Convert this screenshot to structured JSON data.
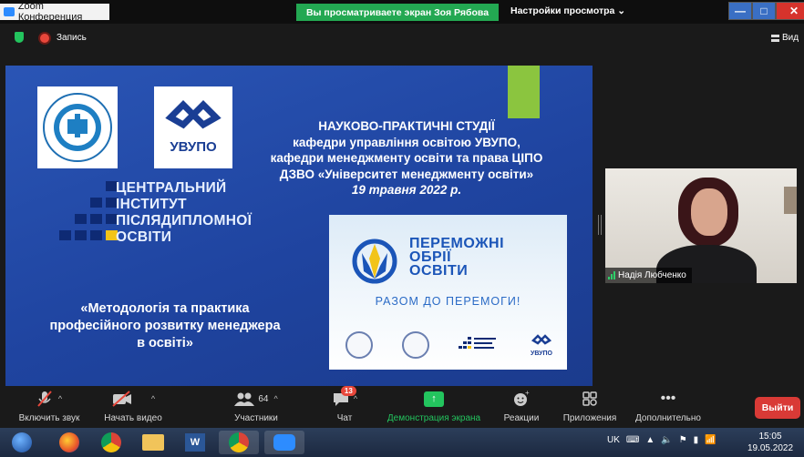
{
  "window": {
    "app_title": "Zoom Конференция",
    "share_banner": "Вы просматриваете экран Зоя Рябова",
    "view_options": "Настройки просмотра"
  },
  "meeting": {
    "recording_label": "Запись",
    "view_label": "Вид"
  },
  "slide": {
    "uvupo_logo_text": "УВУПО",
    "cipo_lines": [
      "ЦЕНТРАЛЬНИЙ",
      "ІНСТИТУТ",
      "ПІСЛЯДИПЛОМНОЇ",
      "ОСВІТИ"
    ],
    "heading_lines": [
      "НАУКОВО-ПРАКТИЧНІ СТУДІЇ",
      "кафедри управління освітою УВУПО,",
      "кафедри менеджменту освіти та права ЦІПО",
      "ДЗВО «Університет менеджменту освіти»"
    ],
    "date": "19 травня 2022 р.",
    "topic_lines": [
      "«Методологія та практика",
      "професійного розвитку менеджера",
      "в освіті»"
    ],
    "poster": {
      "title_lines": [
        "ПЕРЕМОЖНІ",
        "ОБРІЇ",
        "ОСВІТИ"
      ],
      "slogan": "РАЗОМ ДО ПЕРЕМОГИ!",
      "mini_uvupo": "УВУПО"
    }
  },
  "participant": {
    "name": "Надія Любченко"
  },
  "toolbar": {
    "mute": "Включить звук",
    "video": "Начать видео",
    "participants": "Участники",
    "participants_count": "64",
    "chat": "Чат",
    "chat_badge": "13",
    "share": "Демонстрация экрана",
    "reactions": "Реакции",
    "apps": "Приложения",
    "more": "Дополнительно",
    "leave": "Выйти"
  },
  "taskbar": {
    "lang": "UK",
    "time": "15:05",
    "date": "19.05.2022"
  },
  "colors": {
    "share_green": "#23a852",
    "slide_blue": "#2a55b5",
    "leave_red": "#d93a36"
  }
}
